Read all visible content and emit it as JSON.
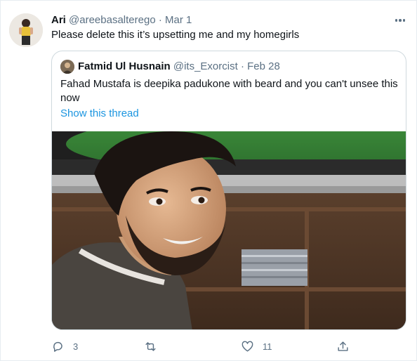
{
  "tweet": {
    "author_name": "Ari",
    "author_handle": "@areebasalterego",
    "separator": "·",
    "date": "Mar 1",
    "text": "Please delete this it’s upsetting me and my homegirls",
    "more_icon": "more-dots-icon"
  },
  "quoted": {
    "author_name": "Fatmid Ul Husnain",
    "author_handle": "@its_Exorcist",
    "separator": "·",
    "date": "Feb 28",
    "text": "Fahad Mustafa is deepika padukone with beard and you can't unsee this now",
    "show_thread": "Show this thread"
  },
  "actions": {
    "reply": {
      "icon": "reply-icon",
      "count": "3"
    },
    "retweet": {
      "icon": "retweet-icon",
      "count": ""
    },
    "like": {
      "icon": "heart-icon",
      "count": "11"
    },
    "share": {
      "icon": "share-icon",
      "count": ""
    }
  },
  "colors": {
    "text": "#0f1419",
    "secondary": "#5b7083",
    "link": "#1b95e0",
    "border": "#cfd9de"
  }
}
